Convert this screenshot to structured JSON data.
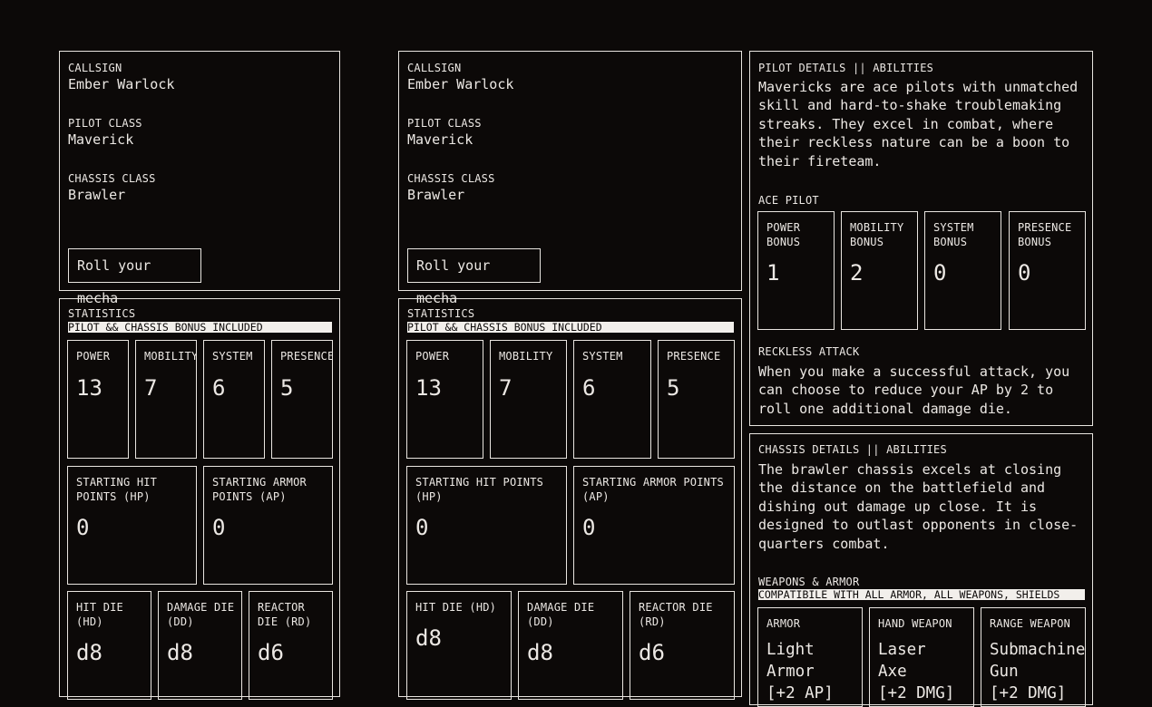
{
  "left": {
    "callsign_label": "CALLSIGN",
    "callsign": "Ember Warlock",
    "pilot_class_label": "PILOT CLASS",
    "pilot_class": "Maverick",
    "chassis_class_label": "CHASSIS CLASS",
    "chassis_class": "Brawler",
    "roll_button": "Roll your mecha",
    "stats_title": "STATISTICS",
    "stats_note": "PILOT && CHASSIS BONUS INCLUDED",
    "stats": [
      {
        "label": "POWER",
        "value": "13"
      },
      {
        "label": "MOBILITY",
        "value": "7"
      },
      {
        "label": "SYSTEM",
        "value": "6"
      },
      {
        "label": "PRESENCE",
        "value": "5"
      }
    ],
    "points": [
      {
        "label": "STARTING HIT\nPOINTS (HP)",
        "value": "0"
      },
      {
        "label": "STARTING ARMOR\nPOINTS (AP)",
        "value": "0"
      }
    ],
    "dice": [
      {
        "label": "HIT DIE\n(HD)",
        "value": "d8"
      },
      {
        "label": "DAMAGE DIE\n(DD)",
        "value": "d8"
      },
      {
        "label": "REACTOR\nDIE (RD)",
        "value": "d6"
      }
    ]
  },
  "middle": {
    "callsign_label": "CALLSIGN",
    "callsign": "Ember Warlock",
    "pilot_class_label": "PILOT CLASS",
    "pilot_class": "Maverick",
    "chassis_class_label": "CHASSIS CLASS",
    "chassis_class": "Brawler",
    "roll_button": "Roll your mecha",
    "stats_title": "STATISTICS",
    "stats_note": "PILOT && CHASSIS BONUS INCLUDED",
    "stats": [
      {
        "label": "POWER",
        "value": "13"
      },
      {
        "label": "MOBILITY",
        "value": "7"
      },
      {
        "label": "SYSTEM",
        "value": "6"
      },
      {
        "label": "PRESENCE",
        "value": "5"
      }
    ],
    "points": [
      {
        "label": "STARTING HIT POINTS\n(HP)",
        "value": "0"
      },
      {
        "label": "STARTING ARMOR POINTS\n(AP)",
        "value": "0"
      }
    ],
    "dice": [
      {
        "label": "HIT DIE (HD)",
        "value": "d8"
      },
      {
        "label": "DAMAGE DIE\n(DD)",
        "value": "d8"
      },
      {
        "label": "REACTOR DIE\n(RD)",
        "value": "d6"
      }
    ]
  },
  "pilot": {
    "title": "PILOT DETAILS || ABILITIES",
    "description": "Mavericks are ace pilots with unmatched skill and hard-to-shake troublemaking streaks. They excel in combat, where their reckless nature can be a boon to their fireteam.",
    "ace_title": "ACE PILOT",
    "bonuses": [
      {
        "label": "POWER\nBONUS",
        "value": "1"
      },
      {
        "label": "MOBILITY\nBONUS",
        "value": "2"
      },
      {
        "label": "SYSTEM\nBONUS",
        "value": "0"
      },
      {
        "label": "PRESENCE\nBONUS",
        "value": "0"
      }
    ],
    "ability_title": "RECKLESS ATTACK",
    "ability_text": "When you make a successful attack, you can choose to reduce your AP by 2 to roll one additional damage die."
  },
  "chassis": {
    "title": "CHASSIS DETAILS || ABILITIES",
    "description": "The brawler chassis excels at closing the distance on the battlefield and dishing out damage up close. It is designed to outlast opponents in close-quarters combat.",
    "weapons_title": "WEAPONS & ARMOR",
    "weapons_note": "COMPATIBILE WITH ALL ARMOR, ALL WEAPONS, SHIELDS",
    "items": [
      {
        "label": "ARMOR",
        "value": "Light\nArmor\n[+2 AP]"
      },
      {
        "label": "HAND WEAPON",
        "value": "Laser\nAxe\n[+2 DMG]"
      },
      {
        "label": "RANGE WEAPON",
        "value": "Submachine\nGun\n[+2 DMG]"
      }
    ]
  }
}
